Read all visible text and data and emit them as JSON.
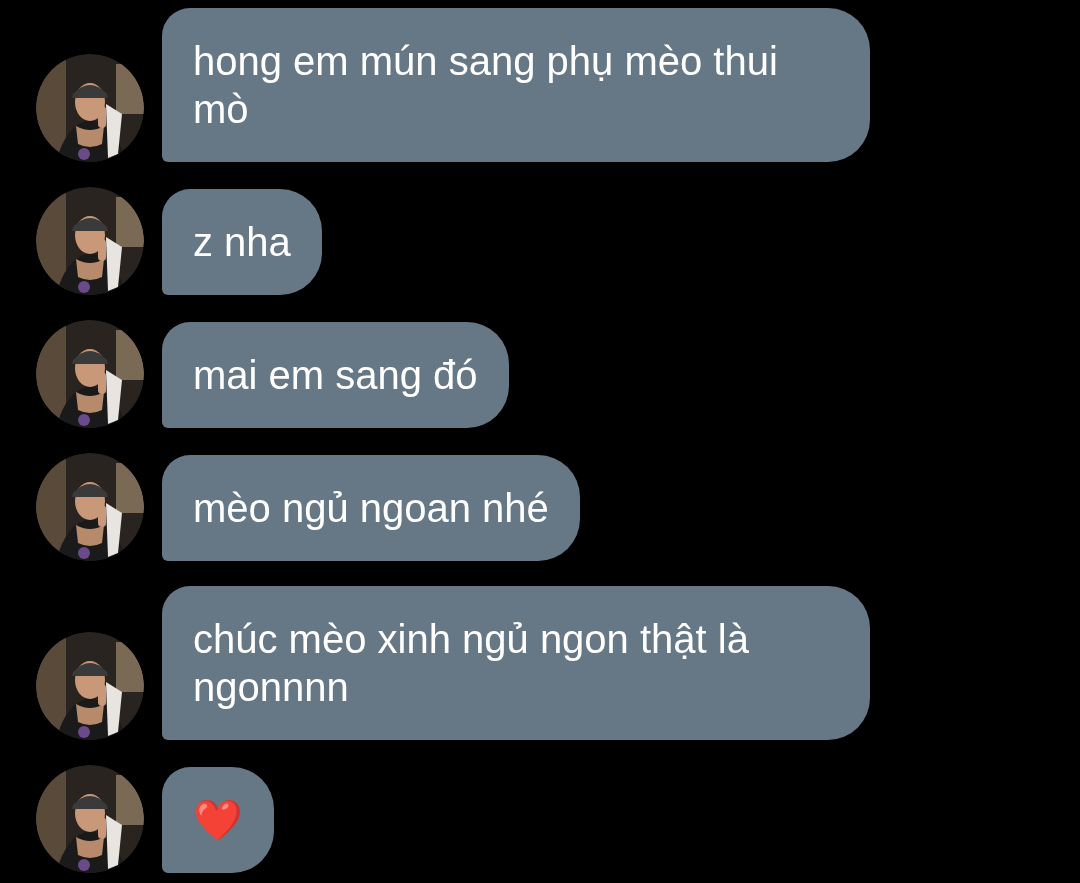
{
  "messages": [
    {
      "text": "hong em mún sang phụ mèo thui mò"
    },
    {
      "text": "z nha"
    },
    {
      "text": "mai em sang đó"
    },
    {
      "text": "mèo ngủ ngoan nhé"
    },
    {
      "text": "chúc mèo xinh ngủ ngon thật là ngonnnn"
    },
    {
      "text": "❤️"
    }
  ]
}
